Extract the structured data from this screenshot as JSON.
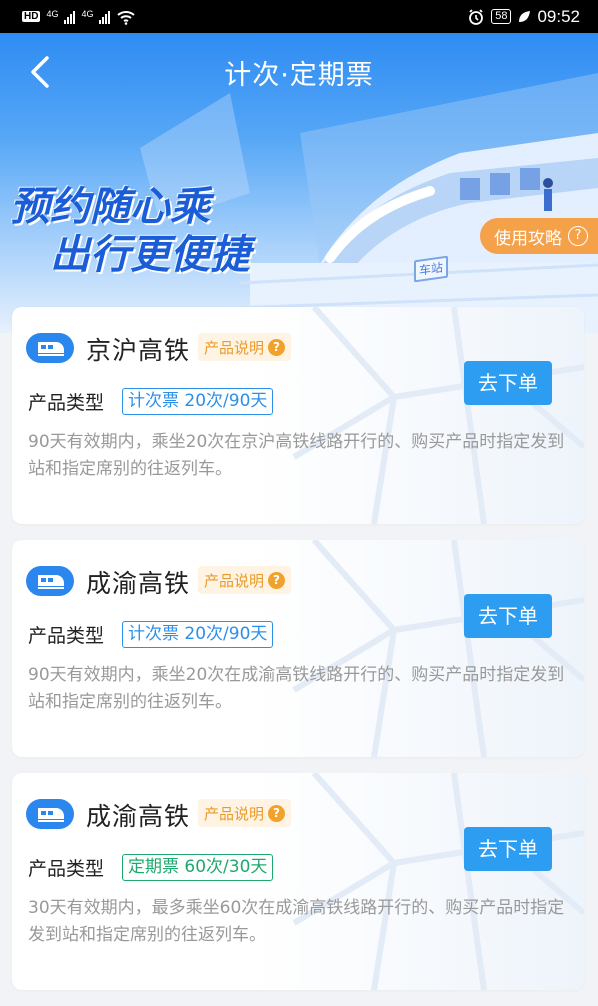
{
  "status_bar": {
    "left_label": "HD",
    "net1": "4G",
    "net2": "4G",
    "battery": "58",
    "time": "09:52"
  },
  "header": {
    "title": "计次·定期票",
    "back_icon": "chevron-left-icon"
  },
  "banner": {
    "slogan_line1": "预约随心乘",
    "slogan_line2": "出行更便捷",
    "station_sign": "车站",
    "guide_button": "使用攻略",
    "guide_icon": "?"
  },
  "cards": [
    {
      "name": "京沪高铁",
      "desc_tag": "产品说明",
      "desc_tag_icon": "?",
      "type_label": "产品类型",
      "type_badge": "计次票 20次/90天",
      "badge_color": "blue",
      "description": "90天有效期内，乘坐20次在京沪高铁线路开行的、购买产品时指定发到站和指定席别的往返列车。",
      "order_button": "去下单"
    },
    {
      "name": "成渝高铁",
      "desc_tag": "产品说明",
      "desc_tag_icon": "?",
      "type_label": "产品类型",
      "type_badge": "计次票 20次/90天",
      "badge_color": "blue",
      "description": "90天有效期内，乘坐20次在成渝高铁线路开行的、购买产品时指定发到站和指定席别的往返列车。",
      "order_button": "去下单"
    },
    {
      "name": "成渝高铁",
      "desc_tag": "产品说明",
      "desc_tag_icon": "?",
      "type_label": "产品类型",
      "type_badge": "定期票 60次/30天",
      "badge_color": "green",
      "description": "30天有效期内，最多乘坐60次在成渝高铁线路开行的、购买产品时指定发到站和指定席别的往返列车。",
      "order_button": "去下单"
    }
  ],
  "colors": {
    "primary": "#2c9df0",
    "guide_orange": "#f5a14a",
    "badge_blue": "#2c8fe9",
    "badge_green": "#1fa86e"
  }
}
